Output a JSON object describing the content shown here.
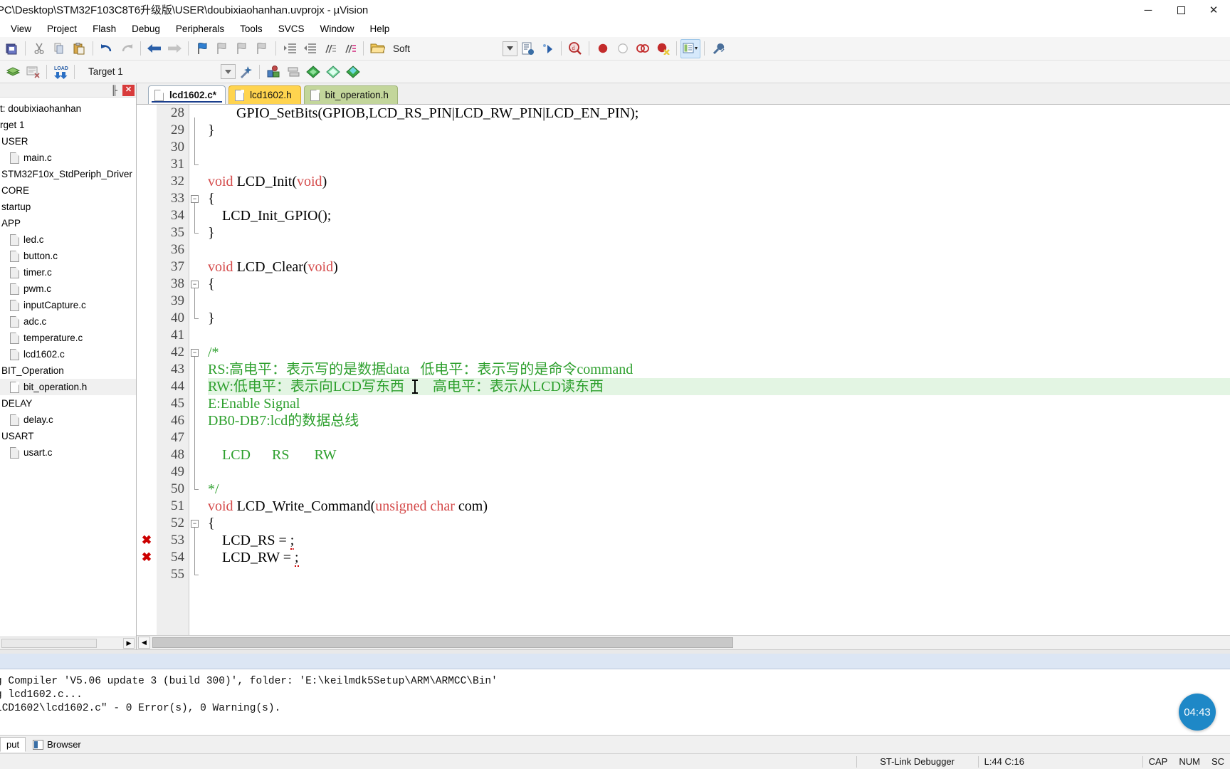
{
  "window": {
    "title": "PC\\Desktop\\STM32F103C8T6升级版\\USER\\doubixiaohanhan.uvprojx - µVision",
    "minimize": "─",
    "maximize": "☐",
    "close": "✕"
  },
  "menubar": {
    "items": [
      {
        "label": "View"
      },
      {
        "label": "Project"
      },
      {
        "label": "Flash"
      },
      {
        "label": "Debug"
      },
      {
        "label": "Peripherals"
      },
      {
        "label": "Tools"
      },
      {
        "label": "SVCS"
      },
      {
        "label": "Window"
      },
      {
        "label": "Help"
      }
    ]
  },
  "toolbar1": {
    "icons": [
      "save-all-icon",
      "cut-icon",
      "copy-icon",
      "paste-icon",
      "undo-icon",
      "redo-icon",
      "navigate-back-icon",
      "navigate-forward-icon",
      "bookmark-toggle-icon",
      "bookmark-prev-icon",
      "bookmark-next-icon",
      "bookmark-clear-icon",
      "indent-icon",
      "outdent-icon",
      "comment-icon",
      "uncomment-icon"
    ],
    "open_file_icon": "open-folder-icon",
    "scheme_label": "Soft",
    "dropdown_icon": "chevron-down-icon",
    "after_icons": [
      "insert-file-icon",
      "configure-icon",
      "find-in-files-icon",
      "breakpoint-icon",
      "breakpoint-disable-icon",
      "breakpoint-clear-icon",
      "breakpoint-kill-icon"
    ],
    "window_layout_icon": "window-layout-icon",
    "window_layout_caret": "▼",
    "options_icon": "wrench-icon"
  },
  "toolbar2": {
    "icons": [
      "build-target-icon",
      "rebuild-icon",
      "load-icon"
    ],
    "load_label": "LOAD",
    "target_label": "Target 1",
    "target_dropdown_icon": "chevron-down-icon",
    "magic_wand_icon": "target-options-icon",
    "manage_icons": [
      "manage-project-items-icon",
      "batch-build-icon",
      "book1-icon",
      "book2-icon",
      "book3-icon"
    ]
  },
  "project_pane": {
    "pin_icon": "pin-icon",
    "close_icon": "close-icon",
    "tree": [
      {
        "label": "t: doubixiaohanhan",
        "type": "project",
        "indent": 0,
        "selected": false
      },
      {
        "label": "rget 1",
        "type": "target",
        "indent": 0,
        "selected": false
      },
      {
        "label": "USER",
        "type": "group",
        "indent": 1,
        "selected": false
      },
      {
        "label": "main.c",
        "type": "file",
        "indent": 2,
        "selected": false
      },
      {
        "label": "STM32F10x_StdPeriph_Driver",
        "type": "group",
        "indent": 1,
        "selected": false
      },
      {
        "label": "CORE",
        "type": "group",
        "indent": 1,
        "selected": false
      },
      {
        "label": "startup",
        "type": "group",
        "indent": 1,
        "selected": false
      },
      {
        "label": "APP",
        "type": "group",
        "indent": 1,
        "selected": false
      },
      {
        "label": "led.c",
        "type": "file",
        "indent": 2,
        "selected": false
      },
      {
        "label": "button.c",
        "type": "file",
        "indent": 2,
        "selected": false
      },
      {
        "label": "timer.c",
        "type": "file",
        "indent": 2,
        "selected": false
      },
      {
        "label": "pwm.c",
        "type": "file",
        "indent": 2,
        "selected": false
      },
      {
        "label": "inputCapture.c",
        "type": "file",
        "indent": 2,
        "selected": false
      },
      {
        "label": "adc.c",
        "type": "file",
        "indent": 2,
        "selected": false
      },
      {
        "label": "temperature.c",
        "type": "file",
        "indent": 2,
        "selected": false
      },
      {
        "label": "lcd1602.c",
        "type": "file",
        "indent": 2,
        "selected": false
      },
      {
        "label": "BIT_Operation",
        "type": "group",
        "indent": 1,
        "selected": false
      },
      {
        "label": "bit_operation.h",
        "type": "file",
        "indent": 2,
        "selected": true
      },
      {
        "label": "DELAY",
        "type": "group",
        "indent": 1,
        "selected": false
      },
      {
        "label": "delay.c",
        "type": "file",
        "indent": 2,
        "selected": false
      },
      {
        "label": "USART",
        "type": "group",
        "indent": 1,
        "selected": false
      },
      {
        "label": "usart.c",
        "type": "file",
        "indent": 2,
        "selected": false
      }
    ]
  },
  "editor": {
    "tabs": [
      {
        "label": "lcd1602.c*",
        "state": "active"
      },
      {
        "label": "lcd1602.h",
        "state": "yellow"
      },
      {
        "label": "bit_operation.h",
        "state": "green"
      }
    ],
    "first_line": 28,
    "highlight_line": 44,
    "error_lines": [
      53,
      54
    ],
    "lines": [
      {
        "n": 28,
        "segments": [
          {
            "t": "        GPIO_SetBits(GPIOB,LCD_RS_PIN|LCD_RW_PIN|LCD_EN_PIN);",
            "c": "plain"
          }
        ]
      },
      {
        "n": 29,
        "segments": [
          {
            "t": "}",
            "c": "plain"
          }
        ]
      },
      {
        "n": 30,
        "segments": [
          {
            "t": "",
            "c": "plain"
          }
        ]
      },
      {
        "n": 31,
        "segments": [
          {
            "t": "",
            "c": "plain"
          }
        ]
      },
      {
        "n": 32,
        "segments": [
          {
            "t": "void",
            "c": "kw"
          },
          {
            "t": " LCD_Init(",
            "c": "plain"
          },
          {
            "t": "void",
            "c": "kw"
          },
          {
            "t": ")",
            "c": "plain"
          }
        ]
      },
      {
        "n": 33,
        "segments": [
          {
            "t": "{",
            "c": "plain"
          }
        ]
      },
      {
        "n": 34,
        "segments": [
          {
            "t": "    LCD_Init_GPIO();",
            "c": "plain"
          }
        ]
      },
      {
        "n": 35,
        "segments": [
          {
            "t": "}",
            "c": "plain"
          }
        ]
      },
      {
        "n": 36,
        "segments": [
          {
            "t": "",
            "c": "plain"
          }
        ]
      },
      {
        "n": 37,
        "segments": [
          {
            "t": "void",
            "c": "kw"
          },
          {
            "t": " LCD_Clear(",
            "c": "plain"
          },
          {
            "t": "void",
            "c": "kw"
          },
          {
            "t": ")",
            "c": "plain"
          }
        ]
      },
      {
        "n": 38,
        "segments": [
          {
            "t": "{",
            "c": "plain"
          }
        ]
      },
      {
        "n": 39,
        "segments": [
          {
            "t": "",
            "c": "plain"
          }
        ]
      },
      {
        "n": 40,
        "segments": [
          {
            "t": "}",
            "c": "plain"
          }
        ]
      },
      {
        "n": 41,
        "segments": [
          {
            "t": "",
            "c": "plain"
          }
        ]
      },
      {
        "n": 42,
        "segments": [
          {
            "t": "/*",
            "c": "cmt"
          }
        ]
      },
      {
        "n": 43,
        "segments": [
          {
            "t": "RS:高电平：表示写的是数据data   低电平：表示写的是命令command",
            "c": "cmt"
          }
        ]
      },
      {
        "n": 44,
        "segments": [
          {
            "t": "RW:低电平：表示向LCD写东西        高电平：表示从LCD读东西",
            "c": "cmt"
          }
        ]
      },
      {
        "n": 45,
        "segments": [
          {
            "t": "E:Enable Signal",
            "c": "cmt"
          }
        ]
      },
      {
        "n": 46,
        "segments": [
          {
            "t": "DB0-DB7:lcd的数据总线",
            "c": "cmt"
          }
        ]
      },
      {
        "n": 47,
        "segments": [
          {
            "t": "",
            "c": "plain"
          }
        ]
      },
      {
        "n": 48,
        "segments": [
          {
            "t": "    LCD      RS       RW",
            "c": "cmt"
          }
        ]
      },
      {
        "n": 49,
        "segments": [
          {
            "t": "",
            "c": "plain"
          }
        ]
      },
      {
        "n": 50,
        "segments": [
          {
            "t": "*/",
            "c": "cmt"
          }
        ]
      },
      {
        "n": 51,
        "segments": [
          {
            "t": "void",
            "c": "kw"
          },
          {
            "t": " LCD_Write_Command(",
            "c": "plain"
          },
          {
            "t": "unsigned char",
            "c": "kw"
          },
          {
            "t": " com)",
            "c": "plain"
          }
        ]
      },
      {
        "n": 52,
        "segments": [
          {
            "t": "{",
            "c": "plain"
          }
        ]
      },
      {
        "n": 53,
        "segments": [
          {
            "t": "    LCD_RS = ",
            "c": "plain"
          },
          {
            "t": ";",
            "c": "err"
          }
        ]
      },
      {
        "n": 54,
        "segments": [
          {
            "t": "    LCD_RW = ",
            "c": "plain"
          },
          {
            "t": ";",
            "c": "err"
          }
        ]
      },
      {
        "n": 55,
        "segments": [
          {
            "t": "",
            "c": "plain"
          }
        ]
      }
    ]
  },
  "build_output": {
    "lines": [
      "g Compiler 'V5.06 update 3 (build 300)', folder: 'E:\\keilmdk5Setup\\ARM\\ARMCC\\Bin'",
      "g lcd1602.c...",
      "LCD1602\\lcd1602.c\" - 0 Error(s), 0 Warning(s)."
    ],
    "timer": "04:43"
  },
  "bottom_tabs": {
    "output_label": "put",
    "browser_label": "Browser",
    "browser_icon": "browser-icon"
  },
  "statusbar": {
    "debugger": "ST-Link Debugger",
    "position": "L:44 C:16",
    "caps": "CAP",
    "num": "NUM",
    "scrl": "SC"
  },
  "colors": {
    "keyword": "#d44a4a",
    "comment": "#2ea02e",
    "highlight_line": "#e3f5e3",
    "tab_yellow": "#ffd44f",
    "tab_green": "#c3d69b",
    "error": "#cc0000",
    "accent": "#1e88c7"
  }
}
